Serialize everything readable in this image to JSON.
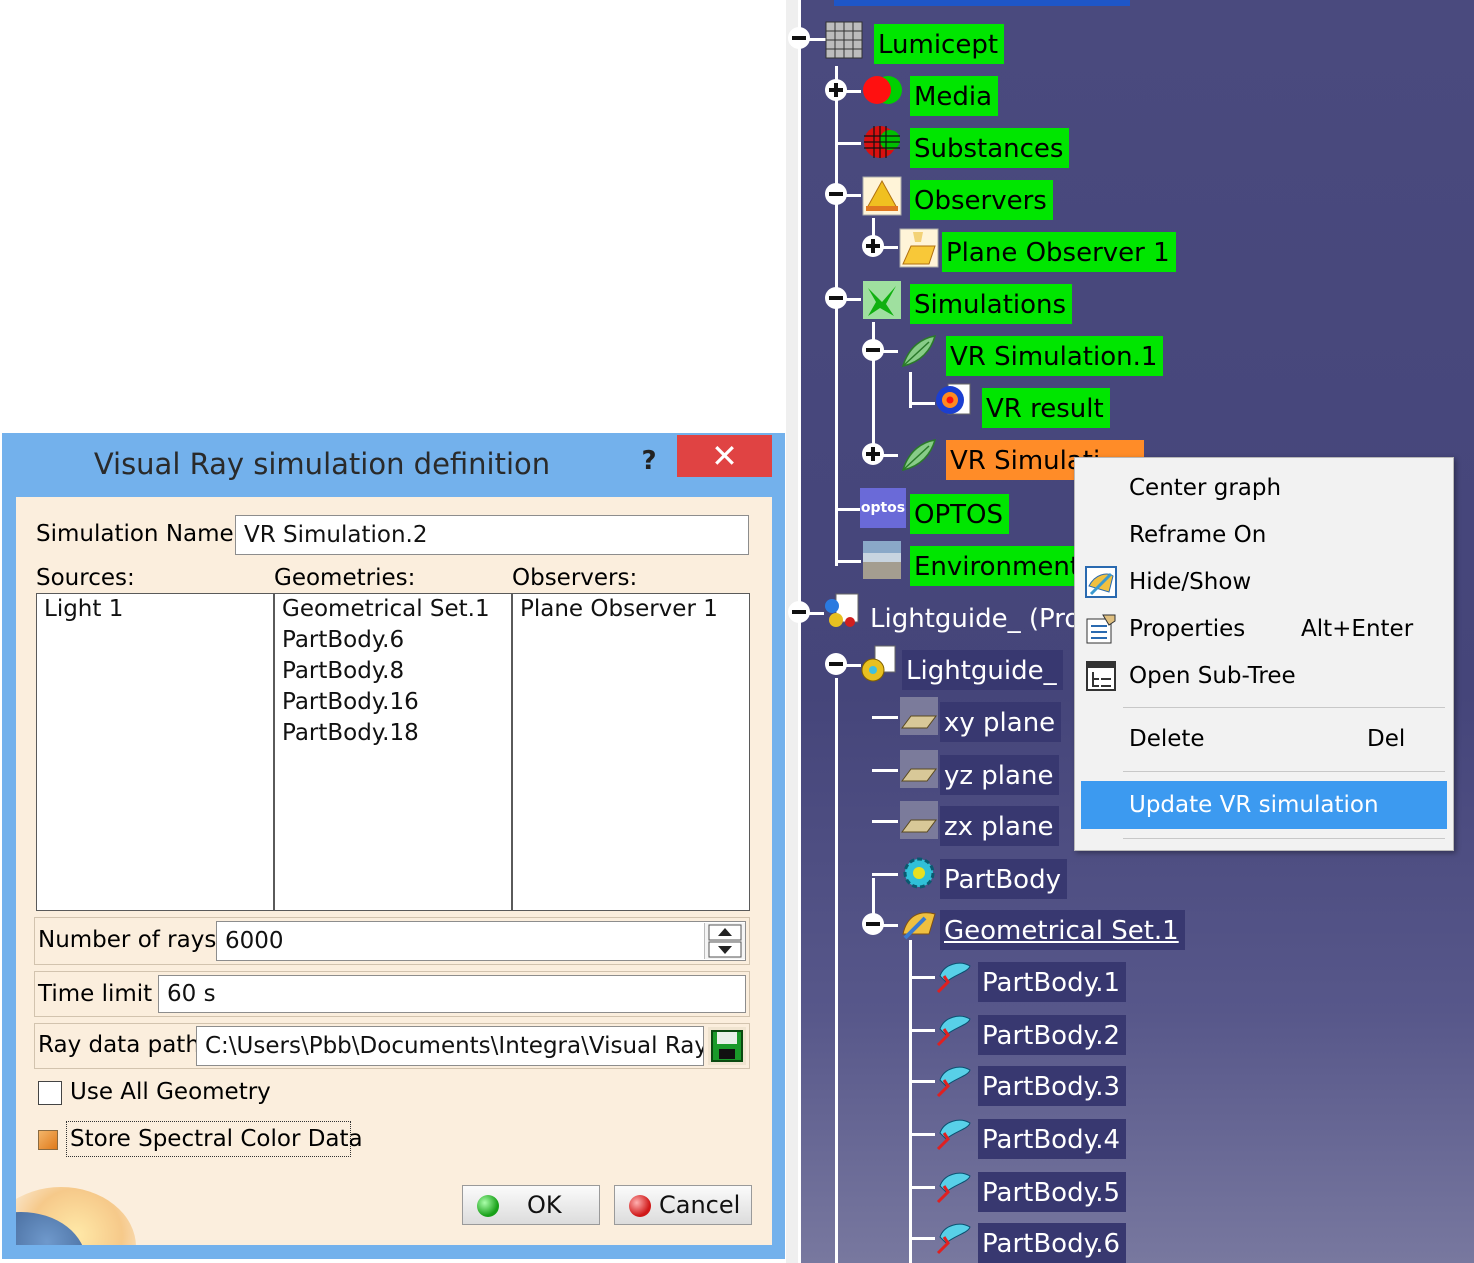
{
  "dialog": {
    "title": "Visual Ray simulation definition",
    "help_label": "?",
    "close_label": "✕",
    "simulation_name_label": "Simulation Name:",
    "simulation_name_value": "VR Simulation.2",
    "sources_label": "Sources:",
    "geometries_label": "Geometries:",
    "observers_label": "Observers:",
    "sources": [
      "Light 1"
    ],
    "geometries": [
      "Geometrical Set.1",
      "PartBody.6",
      "PartBody.8",
      "PartBody.16",
      "PartBody.18"
    ],
    "observers": [
      "Plane Observer 1"
    ],
    "rays_label": "Number of rays",
    "rays_value": "6000",
    "time_label": "Time limit",
    "time_value": "60 s",
    "path_label": "Ray data path",
    "path_value": "C:\\Users\\Pbb\\Documents\\Integra\\Visual Ray",
    "use_all_label": "Use All Geometry",
    "use_all_checked": false,
    "spectral_label": "Store Spectral Color Data",
    "spectral_checked": true,
    "ok_label": "OK",
    "cancel_label": "Cancel"
  },
  "tree": {
    "items": [
      {
        "label": "Lumicept",
        "icon": "grid-icon"
      },
      {
        "label": "Media",
        "icon": "media-icon"
      },
      {
        "label": "Substances",
        "icon": "globe-grid-icon"
      },
      {
        "label": "Observers",
        "icon": "observer-icon"
      },
      {
        "label": "Plane Observer 1",
        "icon": "plane-observer-icon"
      },
      {
        "label": "Simulations",
        "icon": "simulation-icon"
      },
      {
        "label": "VR Simulation.1",
        "icon": "leaf-icon"
      },
      {
        "label": "VR result",
        "icon": "result-icon"
      },
      {
        "label": "VR Simulati",
        "icon": "leaf-icon"
      },
      {
        "label": "OPTOS",
        "icon": "optos-icon"
      },
      {
        "label": "Environment",
        "icon": "environment-icon"
      },
      {
        "label": "Lightguide_ (Proc",
        "icon": "product-icon"
      },
      {
        "label": "Lightguide_",
        "icon": "part-icon"
      },
      {
        "label": "xy plane",
        "icon": "plane-icon"
      },
      {
        "label": "yz plane",
        "icon": "plane-icon"
      },
      {
        "label": "zx plane",
        "icon": "plane-icon"
      },
      {
        "label": "PartBody",
        "icon": "gear-icon"
      },
      {
        "label": "Geometrical Set.1",
        "icon": "geoset-icon"
      },
      {
        "label": "PartBody.1",
        "icon": "surface-icon"
      },
      {
        "label": "PartBody.2",
        "icon": "surface-icon"
      },
      {
        "label": "PartBody.3",
        "icon": "surface-icon"
      },
      {
        "label": "PartBody.4",
        "icon": "surface-icon"
      },
      {
        "label": "PartBody.5",
        "icon": "surface-icon"
      },
      {
        "label": "PartBody.6",
        "icon": "surface-icon"
      }
    ],
    "optos_badge": "optos"
  },
  "context_menu": {
    "items": [
      {
        "label": "Center graph",
        "shortcut": ""
      },
      {
        "label": "Reframe On",
        "shortcut": ""
      },
      {
        "label": "Hide/Show",
        "shortcut": ""
      },
      {
        "label": "Properties",
        "shortcut": "Alt+Enter"
      },
      {
        "label": "Open Sub-Tree",
        "shortcut": ""
      },
      {
        "label": "Delete",
        "shortcut": "Del"
      },
      {
        "label": "Update VR simulation",
        "shortcut": ""
      }
    ]
  },
  "colors": {
    "highlight_green": "#00e600",
    "highlight_orange": "#ff8c28",
    "tree_background": "#4a4a7e",
    "menu_selection": "#3c9af0",
    "dialog_frame": "#73b1ec",
    "dialog_client": "#fbeedd",
    "close_button": "#e04343"
  }
}
